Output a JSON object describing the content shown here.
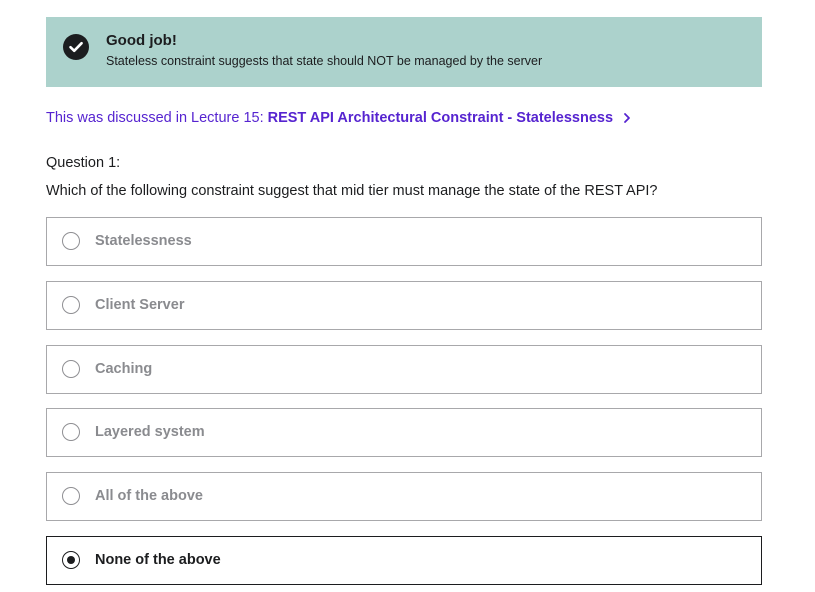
{
  "feedback": {
    "icon": "check-circle-icon",
    "title": "Good job!",
    "message": "Stateless constraint suggests that state should NOT be managed by the server",
    "background_color": "#acd2cc"
  },
  "lecture_link": {
    "prefix": "This was discussed in Lecture 15:",
    "title": "REST API Architectural Constraint - Statelessness",
    "icon": "chevron-right-icon",
    "color": "#5624d0"
  },
  "question": {
    "number_label": "Question 1:",
    "text": "Which of the following constraint suggest that mid tier must manage the state of the REST API?"
  },
  "options": [
    {
      "label": "Statelessness",
      "selected": false
    },
    {
      "label": "Client Server",
      "selected": false
    },
    {
      "label": "Caching",
      "selected": false
    },
    {
      "label": "Layered system",
      "selected": false
    },
    {
      "label": "All of the above",
      "selected": false
    },
    {
      "label": "None of the above",
      "selected": true
    }
  ]
}
